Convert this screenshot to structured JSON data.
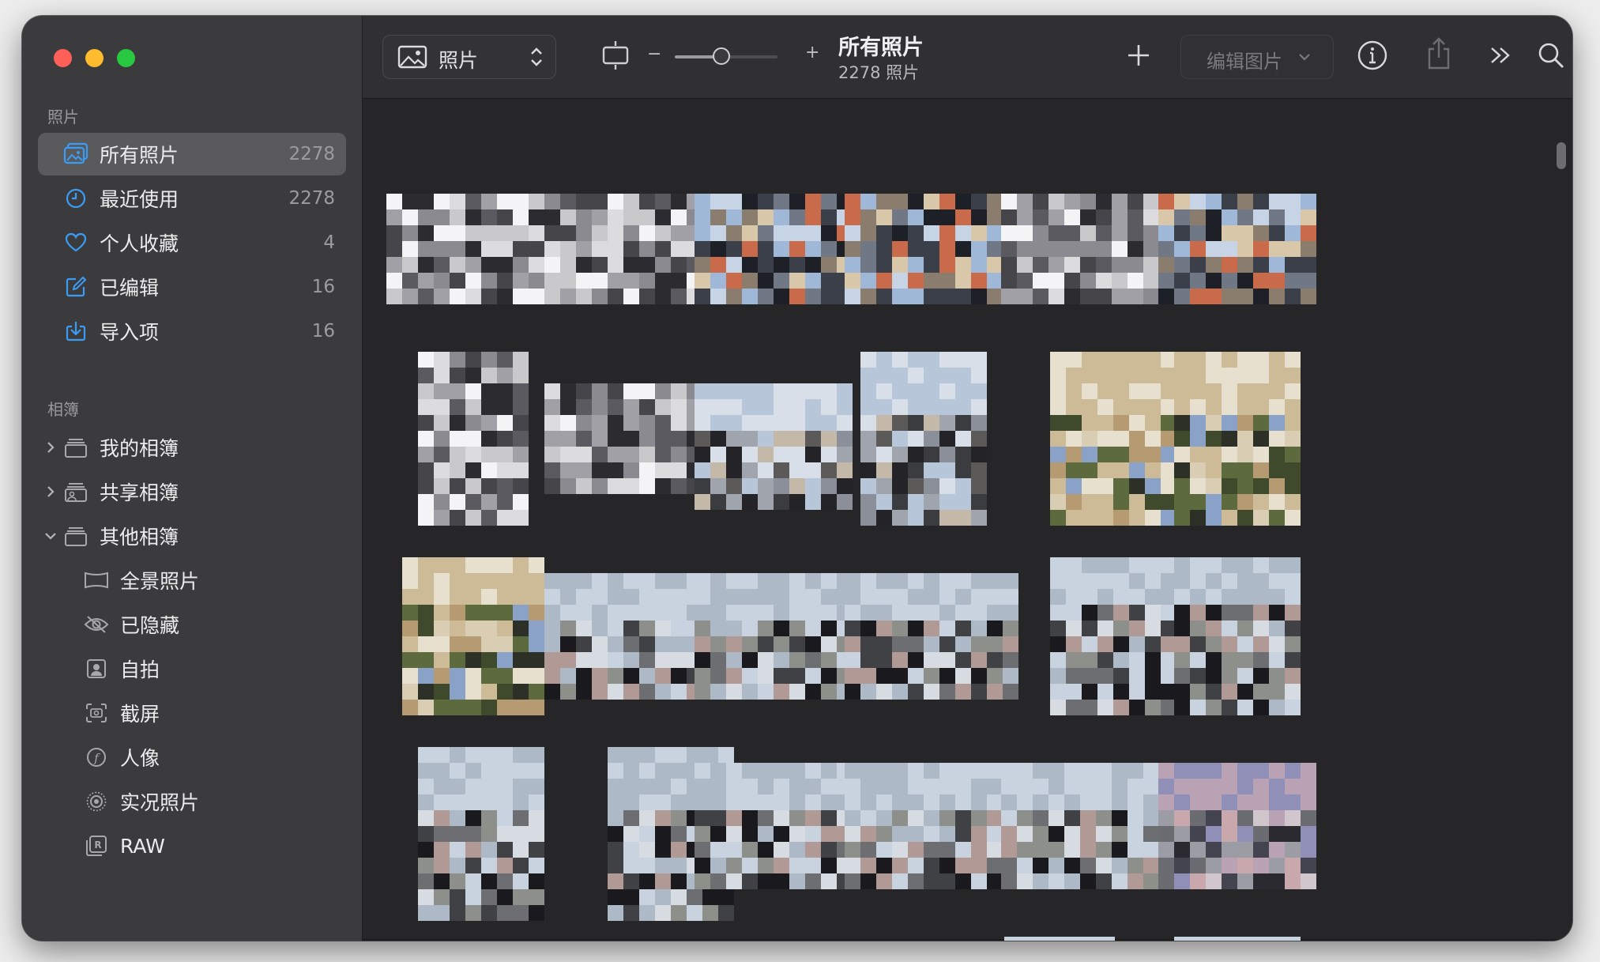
{
  "sidebar": {
    "section_photos": "照片",
    "section_albums": "相簿",
    "items": [
      {
        "label": "所有照片",
        "count": "2278",
        "icon": "photo-library-icon"
      },
      {
        "label": "最近使用",
        "count": "2278",
        "icon": "clock-icon"
      },
      {
        "label": "个人收藏",
        "count": "4",
        "icon": "heart-icon"
      },
      {
        "label": "已编辑",
        "count": "16",
        "icon": "edit-icon"
      },
      {
        "label": "导入项",
        "count": "16",
        "icon": "import-icon"
      }
    ],
    "albums": [
      {
        "label": "我的相簿",
        "icon": "album-stack-icon"
      },
      {
        "label": "共享相簿",
        "icon": "shared-album-icon"
      },
      {
        "label": "其他相簿",
        "icon": "album-stack-icon"
      }
    ],
    "other_albums": [
      {
        "label": "全景照片",
        "icon": "panorama-icon"
      },
      {
        "label": "已隐藏",
        "icon": "eye-slash-icon"
      },
      {
        "label": "自拍",
        "icon": "selfie-icon"
      },
      {
        "label": "截屏",
        "icon": "screenshot-icon"
      },
      {
        "label": "人像",
        "icon": "portrait-icon"
      },
      {
        "label": "实况照片",
        "icon": "live-photo-icon"
      },
      {
        "label": "RAW",
        "icon": "raw-icon"
      }
    ]
  },
  "toolbar": {
    "view_label": "照片",
    "zoom_minus": "−",
    "zoom_plus": "+",
    "zoom_level": 0.45,
    "title": "所有照片",
    "subtitle": "2278 照片",
    "edit_label": "编辑图片"
  },
  "colors": {
    "accent": "#3a9cf5",
    "window_bg": "#262628",
    "sidebar_bg": "#3b3b3d"
  }
}
